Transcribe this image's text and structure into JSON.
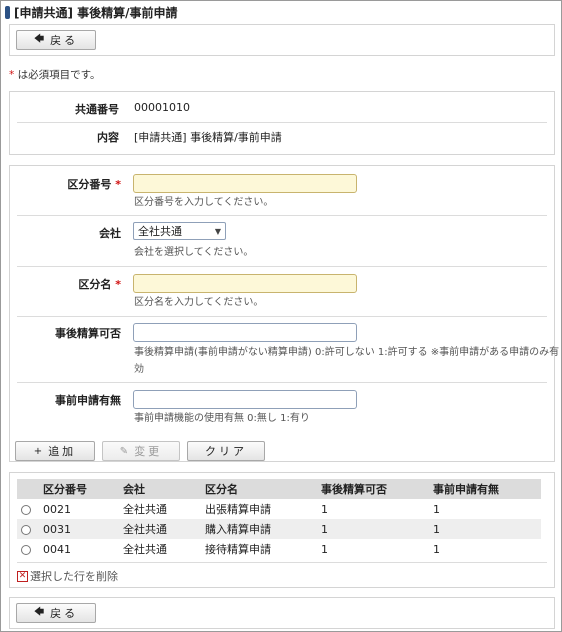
{
  "page": {
    "title": "[申請共通] 事後精算/事前申請",
    "required_note": "は必須項目です。",
    "required_mark": "*"
  },
  "toolbar_top": {
    "back_label": "戻る"
  },
  "info": {
    "code_label": "共通番号",
    "code_value": "00001010",
    "content_label": "内容",
    "content_value": "[申請共通] 事後精算/事前申請"
  },
  "form": {
    "category_no": {
      "label": "区分番号",
      "value": "",
      "hint": "区分番号を入力してください。"
    },
    "company": {
      "label": "会社",
      "selected": "全社共通",
      "hint": "会社を選択してください。"
    },
    "category_name": {
      "label": "区分名",
      "value": "",
      "hint": "区分名を入力してください。"
    },
    "post_settlement": {
      "label": "事後精算可否",
      "value": "",
      "hint_line1": "事後精算申請(事前申請がない精算申請) 0:許可しない 1:許可する ※事前申請がある申請のみ有",
      "hint_line2": "効"
    },
    "pre_application": {
      "label": "事前申請有無",
      "value": "",
      "hint": "事前申請機能の使用有無 0:無し 1:有り"
    }
  },
  "form_actions": {
    "add_label": "追加",
    "edit_label": "変更",
    "clear_label": "クリア"
  },
  "table": {
    "headers": [
      "区分番号",
      "会社",
      "区分名",
      "事後精算可否",
      "事前申請有無"
    ],
    "rows": [
      [
        "0021",
        "全社共通",
        "出張精算申請",
        "1",
        "1"
      ],
      [
        "0031",
        "全社共通",
        "購入精算申請",
        "1",
        "1"
      ],
      [
        "0041",
        "全社共通",
        "接待精算申請",
        "1",
        "1"
      ]
    ],
    "delete_label": "選択した行を削除"
  },
  "toolbar_bottom": {
    "back_label": "戻る"
  },
  "colors": {
    "required_star": "#d01010",
    "title_icon": "#2c5285",
    "required_input_bg": "#fdf8d8"
  }
}
